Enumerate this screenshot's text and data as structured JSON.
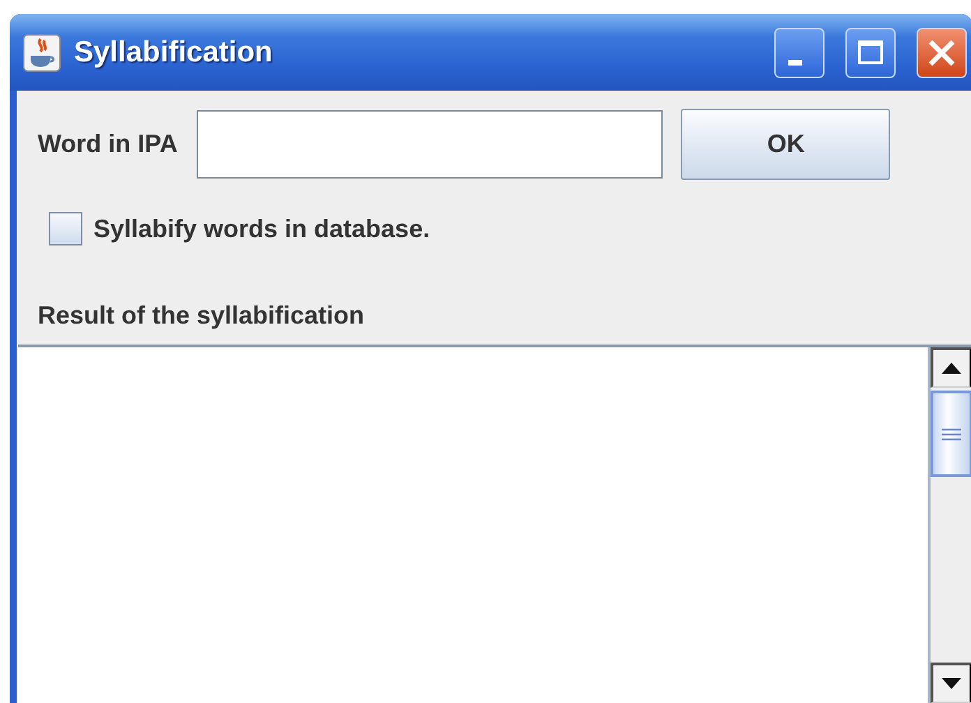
{
  "window": {
    "title": "Syllabification"
  },
  "word_field": {
    "label": "Word in IPA"
  },
  "ok_button": {
    "label": "OK"
  },
  "database_checkbox": {
    "label": "Syllabify words in database.",
    "checked": false
  },
  "result": {
    "label": "Result of the syllabification"
  }
}
